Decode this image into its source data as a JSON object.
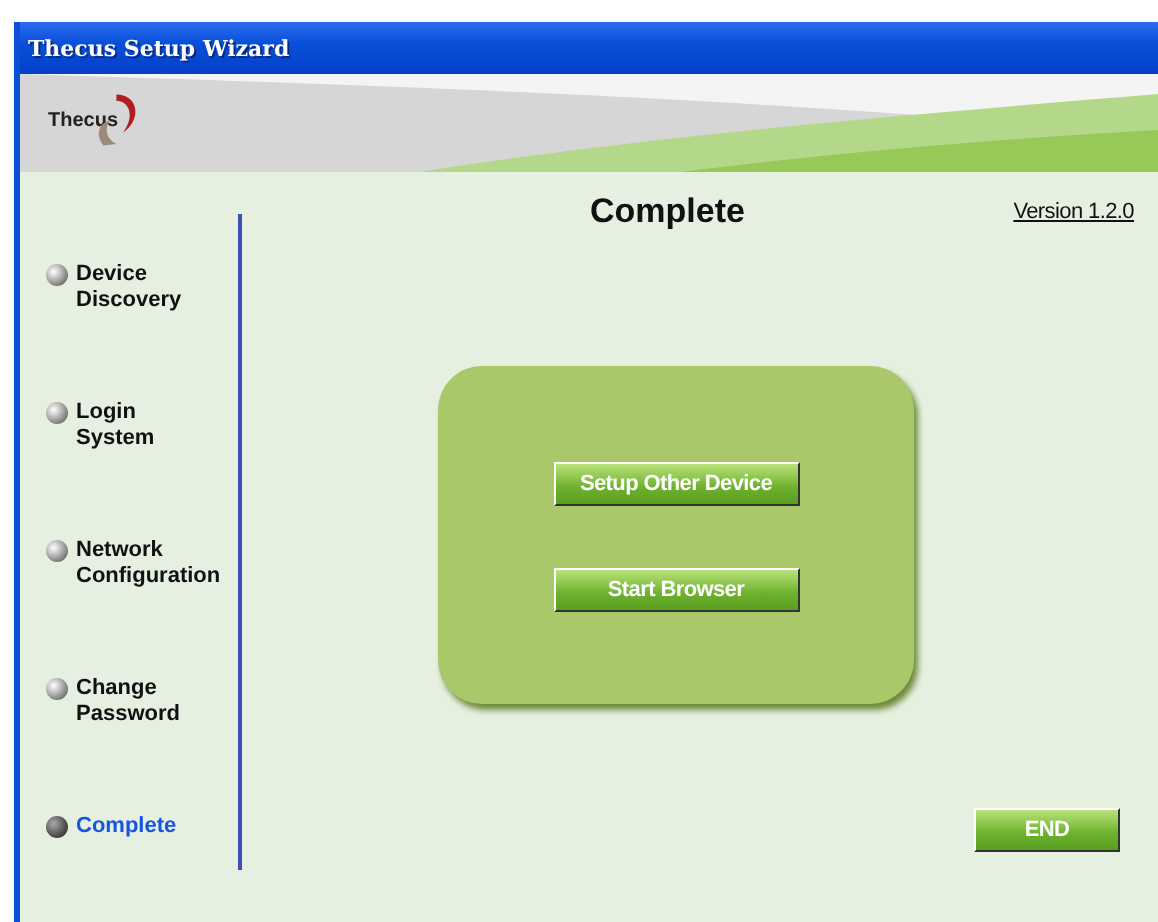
{
  "window": {
    "title": "Thecus Setup Wizard"
  },
  "logo": {
    "text": "Thecus"
  },
  "page": {
    "title": "Complete",
    "version": "Version 1.2.0"
  },
  "steps": [
    {
      "label": "Device Discovery",
      "selected": false
    },
    {
      "label": "Login System",
      "selected": false
    },
    {
      "label": "Network Configuration",
      "selected": false
    },
    {
      "label": "Change Password",
      "selected": false
    },
    {
      "label": "Complete",
      "selected": true
    }
  ],
  "actions": [
    "Setup Other Device",
    "Start Browser"
  ],
  "end_button": "END"
}
